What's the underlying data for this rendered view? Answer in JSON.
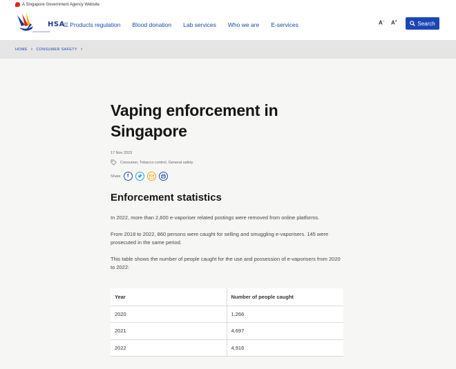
{
  "masthead": {
    "text": "A Singapore Government Agency Website"
  },
  "logo": {
    "text": "HSA"
  },
  "nav": {
    "items": [
      {
        "label": "Products regulation",
        "has_menu": true
      },
      {
        "label": "Blood donation"
      },
      {
        "label": "Lab services"
      },
      {
        "label": "Who we are"
      },
      {
        "label": "E-services"
      }
    ],
    "font_decrease": "A",
    "font_increase": "A",
    "search_label": "Search"
  },
  "breadcrumb": {
    "home": "HOME",
    "section": "CONSUMER SAFETY"
  },
  "article": {
    "title_line1": "Vaping enforcement in",
    "title_line2": "Singapore",
    "date": "17 Nov 2023",
    "tags": "Consumer, Tobacco control, General safety",
    "share_label": "Share",
    "section_heading": "Enforcement statistics",
    "paragraphs": [
      "In 2022, more than 2,600 e-vaporiser related postings were removed from online platforms.",
      "From 2018 to 2022, 860 persons were caught for selling and smuggling e-vaporisers. 145 were prosecuted in the same period.",
      "This table shows the number of people caught for the use and possession of e-vaporisers from 2020 to 2022:"
    ]
  },
  "table": {
    "headers": [
      "Year",
      "Number of people caught"
    ],
    "rows": [
      [
        "2020",
        "1,266"
      ],
      [
        "2021",
        "4,697"
      ],
      [
        "2022",
        "4,916"
      ]
    ]
  },
  "colors": {
    "brand_blue": "#1b47b4",
    "masthead_red": "#e2231a",
    "breadcrumb_bg": "#e5e5e5",
    "content_bg": "#f6f6f4"
  }
}
